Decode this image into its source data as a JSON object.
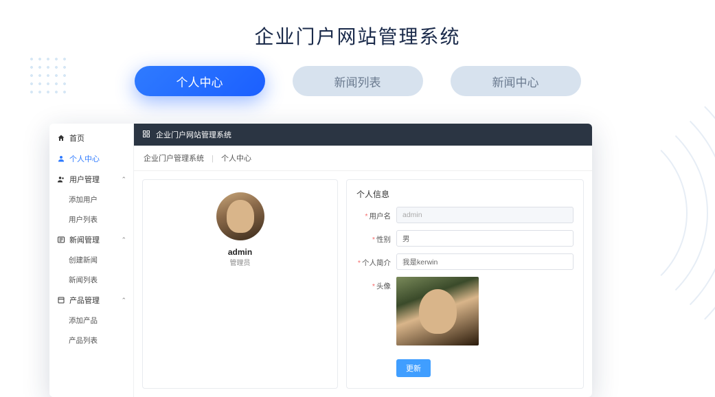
{
  "page": {
    "title": "企业门户网站管理系统"
  },
  "tabs": [
    {
      "label": "个人中心",
      "active": true
    },
    {
      "label": "新闻列表",
      "active": false
    },
    {
      "label": "新闻中心",
      "active": false
    }
  ],
  "topbar": {
    "title": "企业门户网站管理系统"
  },
  "breadcrumb": {
    "root": "企业门户管理系统",
    "current": "个人中心"
  },
  "sidebar": {
    "home": "首页",
    "personal": "个人中心",
    "user_mgmt": {
      "label": "用户管理",
      "children": [
        "添加用户",
        "用户列表"
      ]
    },
    "news_mgmt": {
      "label": "新闻管理",
      "children": [
        "创建新闻",
        "新闻列表"
      ]
    },
    "product_mgmt": {
      "label": "产品管理",
      "children": [
        "添加产品",
        "产品列表"
      ]
    }
  },
  "profile_card": {
    "username": "admin",
    "role": "管理员"
  },
  "form": {
    "section_title": "个人信息",
    "username": {
      "label": "用户名",
      "value": "admin"
    },
    "gender": {
      "label": "性别",
      "value": "男"
    },
    "bio": {
      "label": "个人简介",
      "value": "我是kerwin"
    },
    "avatar": {
      "label": "头像"
    },
    "submit": "更新"
  }
}
